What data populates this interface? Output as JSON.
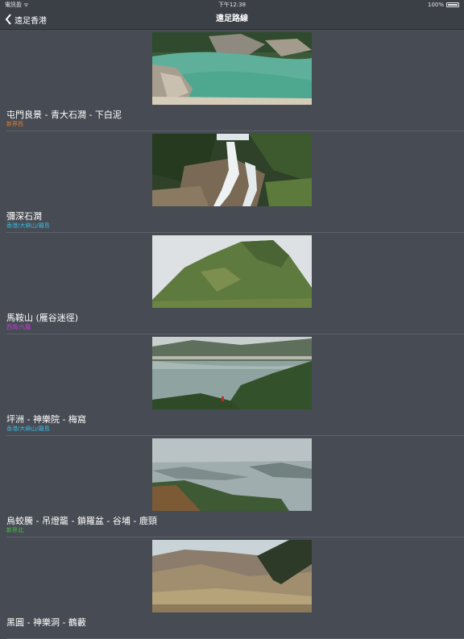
{
  "status_bar": {
    "carrier": "電訊盈 ᯤ",
    "time": "下午12:38",
    "battery": "100%"
  },
  "nav": {
    "back_label": "遠足香港",
    "title": "遠足路線"
  },
  "routes": [
    {
      "title": "屯門良景 - 青大石澗 - 下白泥",
      "region": "新界西",
      "region_color": "#e07a2e",
      "photo_icon": "stream-pool-photo"
    },
    {
      "title": "彌深石澗",
      "region": "香港/大嶼山/離島",
      "region_color": "#38b8e0",
      "photo_icon": "waterfall-photo"
    },
    {
      "title": "馬鞍山 (雁谷迷徑)",
      "region": "西貢/九龍",
      "region_color": "#c040d0",
      "photo_icon": "mountain-peak-photo"
    },
    {
      "title": "坪洲 - 神樂院 - 梅窩",
      "region": "香港/大嶼山/離島",
      "region_color": "#38b8e0",
      "photo_icon": "bay-view-photo"
    },
    {
      "title": "烏蛟騰 - 吊燈籠 - 鎖羅盆 - 谷埔 - 鹿頸",
      "region": "新界北",
      "region_color": "#40c040",
      "photo_icon": "misty-islands-photo"
    },
    {
      "title": "黑圓 - 神樂洞 - 鶴藪",
      "region": "",
      "region_color": "#40c040",
      "photo_icon": "grassland-hills-photo"
    }
  ]
}
